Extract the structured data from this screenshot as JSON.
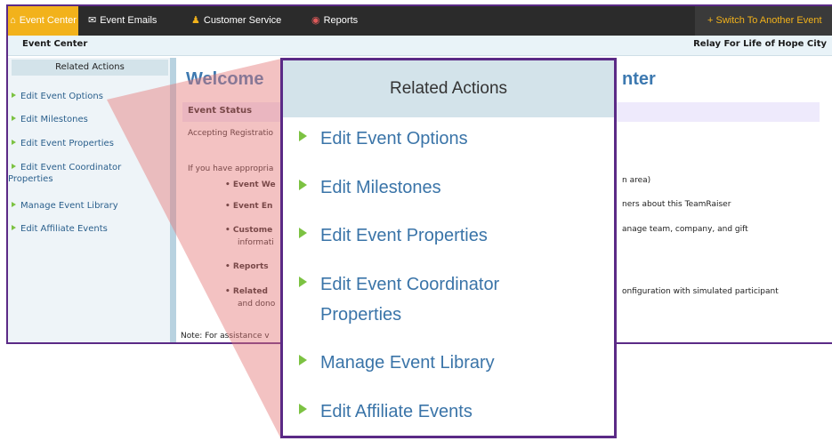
{
  "nav": {
    "items": [
      "Event Center",
      "Event Emails",
      "Customer Service",
      "Reports"
    ],
    "switch_label": "+ Switch To Another Event"
  },
  "subbar": {
    "left": "Event Center",
    "right": "Relay For Life of Hope City"
  },
  "sidebar": {
    "heading": "Related Actions",
    "items": [
      "Edit Event Options",
      "Edit Milestones",
      "Edit Event Properties",
      "Edit Event Coordinator Properties",
      "Manage Event Library",
      "Edit Affiliate Events"
    ]
  },
  "main": {
    "welcome_start": "Welcome",
    "welcome_end": "nter",
    "status_heading": "Event Status",
    "status_value": "Accepting Registratio",
    "intro": "If you have appropria",
    "bullets": [
      "Event We",
      "Event En",
      "Custome",
      "informati",
      "Reports",
      "Related",
      "and dono"
    ],
    "right_texts": [
      "n area)",
      "ners about this TeamRaiser",
      "anage team, company, and gift",
      "onfiguration with simulated participant"
    ],
    "note": "Note: For assistance v"
  },
  "popup": {
    "heading": "Related Actions",
    "items": [
      "Edit Event Options",
      "Edit Milestones",
      "Edit Event Properties",
      "Edit Event Coordinator Properties",
      "Manage Event Library",
      "Edit Affiliate Events"
    ]
  },
  "colors": {
    "accent": "#f2b21b",
    "border": "#5b2a86",
    "link": "#3a74a8",
    "bullet": "#7cc242"
  }
}
